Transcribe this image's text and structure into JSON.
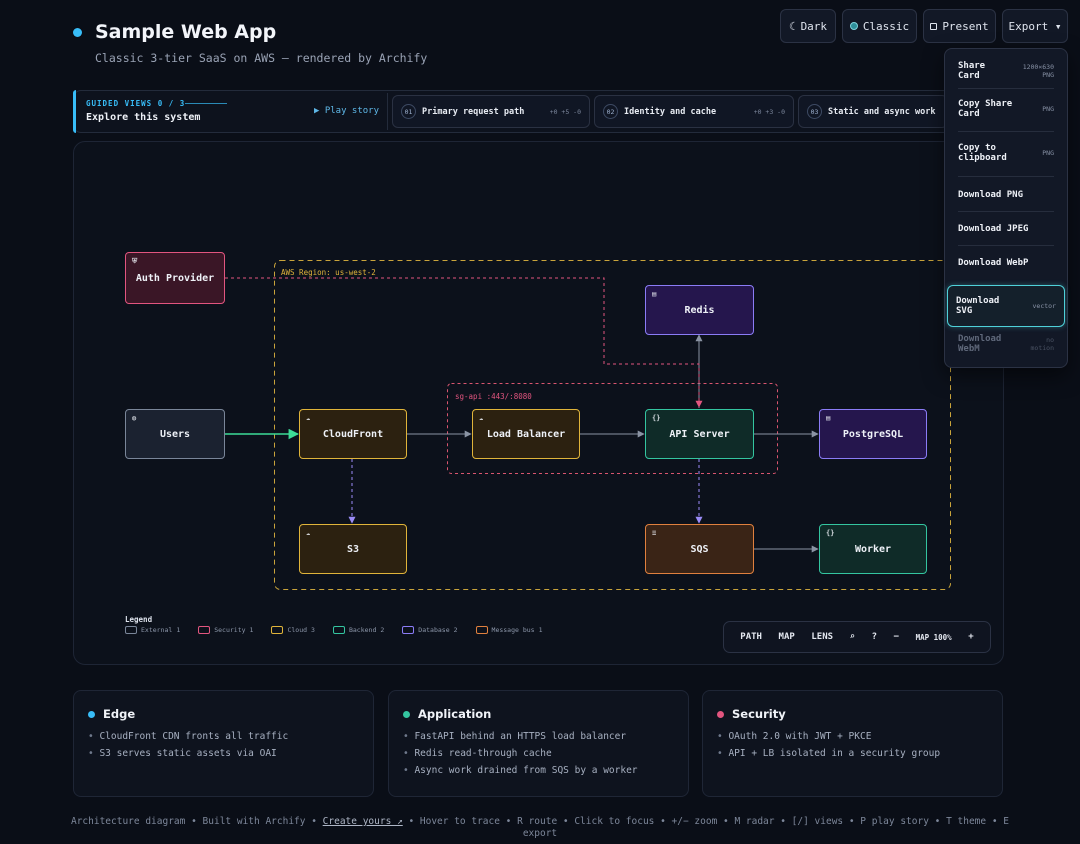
{
  "header": {
    "title": "Sample Web App",
    "subtitle": "Classic 3-tier SaaS on AWS — rendered by Archify"
  },
  "toolbar": {
    "dark_label": "Dark",
    "classic_label": "Classic",
    "present_label": "Present",
    "export_label": "Export ▾"
  },
  "guided": {
    "label": "GUIDED VIEWS 0 / 3",
    "title": "Explore this system",
    "play_label": "▶ Play story",
    "views": [
      {
        "num": "01",
        "title": "Primary request path",
        "counts": "+0 +5 -0"
      },
      {
        "num": "02",
        "title": "Identity and cache",
        "counts": "+0 +3 -0"
      },
      {
        "num": "03",
        "title": "Static and async work",
        "counts": ""
      }
    ]
  },
  "diagram": {
    "region_label": "AWS Region: us-west-2",
    "sg_label": "sg-api :443/:8080",
    "nodes": {
      "auth": "Auth Provider",
      "users": "Users",
      "cloudfront": "CloudFront",
      "lb": "Load Balancer",
      "api": "API Server",
      "postgres": "PostgreSQL",
      "redis": "Redis",
      "s3": "S3",
      "sqs": "SQS",
      "worker": "Worker"
    },
    "legend": {
      "title": "Legend",
      "items": [
        {
          "label": "External",
          "count": "1",
          "color": "#7a8699"
        },
        {
          "label": "Security",
          "count": "1",
          "color": "#e2557f"
        },
        {
          "label": "Cloud",
          "count": "3",
          "color": "#e0b43a"
        },
        {
          "label": "Backend",
          "count": "2",
          "color": "#34c5a0"
        },
        {
          "label": "Database",
          "count": "2",
          "color": "#8b7cf6"
        },
        {
          "label": "Message bus",
          "count": "1",
          "color": "#e0803e"
        }
      ]
    }
  },
  "controls": {
    "path": "PATH",
    "map": "MAP",
    "lens": "LENS",
    "pin": "⌕",
    "help": "?",
    "minus": "−",
    "zoom": "MAP 100%",
    "plus": "+"
  },
  "export_menu": {
    "items": [
      {
        "label": "Share Card",
        "hint": "1200×630 PNG"
      },
      {
        "label": "Copy Share Card",
        "hint": "PNG"
      },
      {
        "label": "Copy to clipboard",
        "hint": "PNG"
      },
      {
        "label": "Download PNG",
        "hint": ""
      },
      {
        "label": "Download JPEG",
        "hint": ""
      },
      {
        "label": "Download WebP",
        "hint": ""
      },
      {
        "label": "Download SVG",
        "hint": "vector"
      },
      {
        "label": "Download WebM",
        "hint": "no motion"
      }
    ]
  },
  "cards": [
    {
      "title": "Edge",
      "color": "#38bdf8",
      "items": [
        "CloudFront CDN fronts all traffic",
        "S3 serves static assets via OAI"
      ]
    },
    {
      "title": "Application",
      "color": "#34c5a0",
      "items": [
        "FastAPI behind an HTTPS load balancer",
        "Redis read-through cache",
        "Async work drained from SQS by a worker"
      ]
    },
    {
      "title": "Security",
      "color": "#e2557f",
      "items": [
        "OAuth 2.0 with JWT + PKCE",
        "API + LB isolated in a security group"
      ]
    }
  ],
  "footer": {
    "part1": "Architecture diagram • Built with Archify • ",
    "link": "Create yours ↗",
    "part2": " • Hover to trace • R route • Click to focus • +/− zoom • M radar • [/] views • P play story • T theme • E export"
  }
}
